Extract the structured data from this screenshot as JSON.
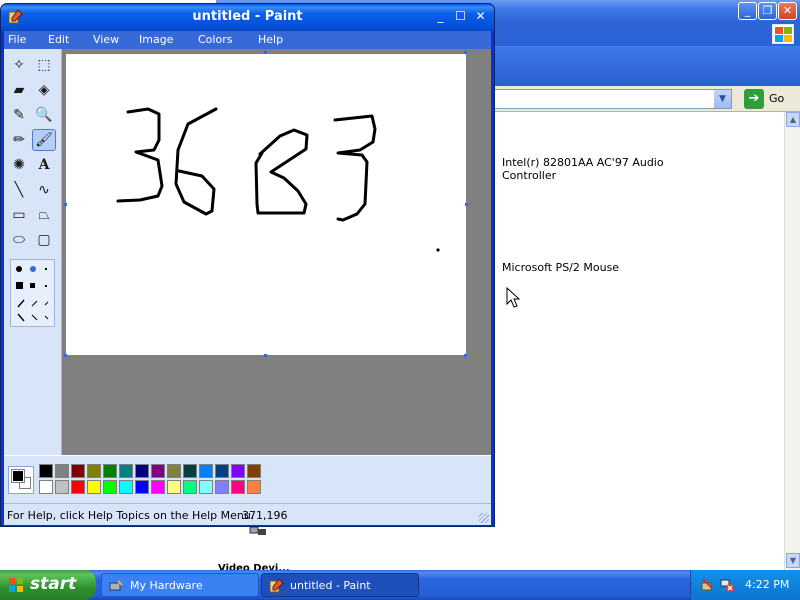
{
  "background_window": {
    "title_buttons": [
      "_",
      "❐",
      "✕"
    ],
    "address": {
      "value": ""
    },
    "go_label": "Go",
    "devices": [
      {
        "name_line1": "Intel(r) 82801AA AC'97 Audio",
        "name_line2": "Controller"
      },
      {
        "name_line1": "Microsoft PS/2 Mouse",
        "name_line2": ""
      }
    ],
    "partial_text": "Video Devi..."
  },
  "paint": {
    "title": "untitled - Paint",
    "menus": [
      "File",
      "Edit",
      "View",
      "Image",
      "Colors",
      "Help"
    ],
    "tools": [
      {
        "name": "free-form-select-icon",
        "glyph": "✧"
      },
      {
        "name": "rect-select-icon",
        "glyph": "⬚"
      },
      {
        "name": "eraser-icon",
        "glyph": "▰"
      },
      {
        "name": "fill-icon",
        "glyph": "◈"
      },
      {
        "name": "color-picker-icon",
        "glyph": "✎"
      },
      {
        "name": "magnifier-icon",
        "glyph": "🔍"
      },
      {
        "name": "pencil-icon",
        "glyph": "✏"
      },
      {
        "name": "brush-icon",
        "glyph": "🖌"
      },
      {
        "name": "airbrush-icon",
        "glyph": "✺"
      },
      {
        "name": "text-icon",
        "glyph": "A"
      },
      {
        "name": "line-icon",
        "glyph": "╲"
      },
      {
        "name": "curve-icon",
        "glyph": "∿"
      },
      {
        "name": "rectangle-icon",
        "glyph": "▭"
      },
      {
        "name": "polygon-icon",
        "glyph": "⏢"
      },
      {
        "name": "ellipse-icon",
        "glyph": "⬭"
      },
      {
        "name": "rounded-rect-icon",
        "glyph": "▢"
      }
    ],
    "selected_tool": "brush-icon",
    "palette_top": [
      "#000000",
      "#808080",
      "#800000",
      "#808000",
      "#008000",
      "#008080",
      "#000080",
      "#800080",
      "#808040",
      "#004040",
      "#0080ff",
      "#004080",
      "#8000ff",
      "#804000"
    ],
    "palette_bottom": [
      "#ffffff",
      "#c0c0c0",
      "#ff0000",
      "#ffff00",
      "#00ff00",
      "#00ffff",
      "#0000ff",
      "#ff00ff",
      "#ffff80",
      "#00ff80",
      "#80ffff",
      "#8080ff",
      "#ff0080",
      "#ff8040"
    ],
    "foreground_color": "#000000",
    "background_color": "#ffffff",
    "status_help": "For Help, click Help Topics on the Help Menu.",
    "status_coords": "371,196"
  },
  "taskbar": {
    "start_label": "start",
    "tasks": [
      {
        "label": "My Hardware",
        "icon": "hardware-icon",
        "active": false
      },
      {
        "label": "untitled - Paint",
        "icon": "paint-icon",
        "active": true
      }
    ],
    "clock": "4:22 PM"
  }
}
